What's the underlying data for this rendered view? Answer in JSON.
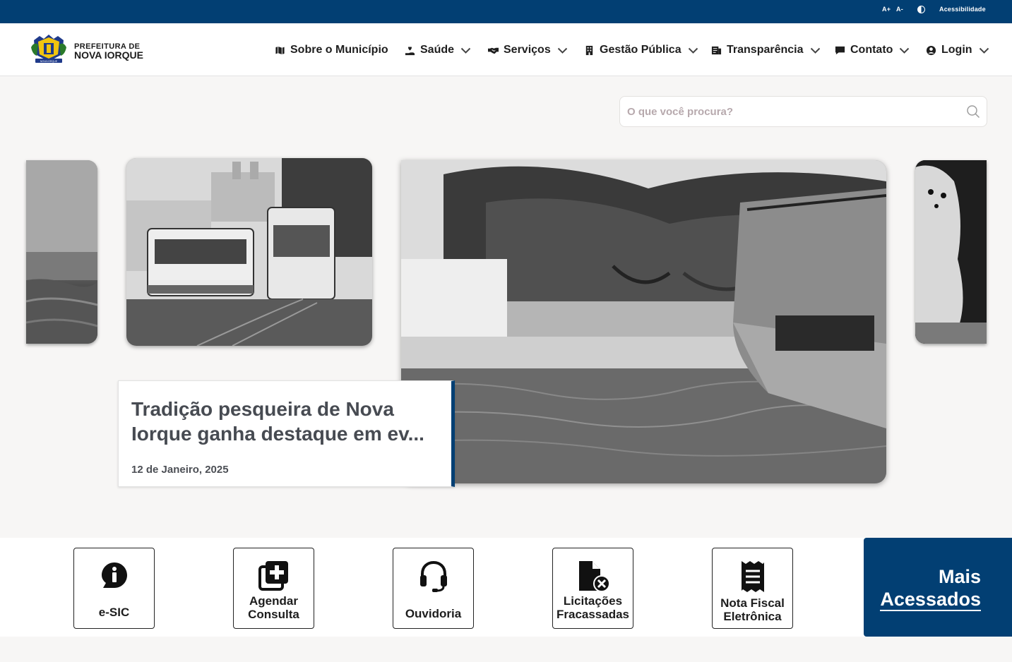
{
  "topbar": {
    "font_increase": "A+",
    "font_decrease": "A-",
    "accessibility": "Acessibilidade"
  },
  "brand": {
    "line1": "PREFEITURA DE",
    "line2": "NOVA IORQUE",
    "logo_text": "NOVA IORQUE"
  },
  "nav": [
    {
      "label": "Sobre o Município",
      "icon": "map-icon"
    },
    {
      "label": "Saúde",
      "icon": "hand-heart-icon"
    },
    {
      "label": "Serviços",
      "icon": "handshake-icon"
    },
    {
      "label": "Gestão Pública",
      "icon": "building-icon"
    },
    {
      "label": "Transparência",
      "icon": "document-icon"
    },
    {
      "label": "Contato",
      "icon": "chat-icon"
    },
    {
      "label": "Login",
      "icon": "user-circle-icon"
    }
  ],
  "search": {
    "placeholder": "O que você procura?"
  },
  "news": {
    "title": "Tradição pesqueira de Nova Iorque ganha destaque em ev...",
    "date": "12 de Janeiro, 2025"
  },
  "quick_access": [
    {
      "label": "e-SIC",
      "icon": "info-chat-icon"
    },
    {
      "label": "Agendar Consulta",
      "icon": "medical-add-icon"
    },
    {
      "label": "Ouvidoria",
      "icon": "headset-icon"
    },
    {
      "label": "Licitações Fracassadas",
      "icon": "document-x-icon"
    },
    {
      "label": "Nota Fiscal Eletrônica",
      "icon": "receipt-icon"
    }
  ],
  "mais_acessados": {
    "line1": "Mais",
    "line2": "Acessados"
  },
  "colors": {
    "primary": "#023f73",
    "background": "#f7f6f5"
  }
}
